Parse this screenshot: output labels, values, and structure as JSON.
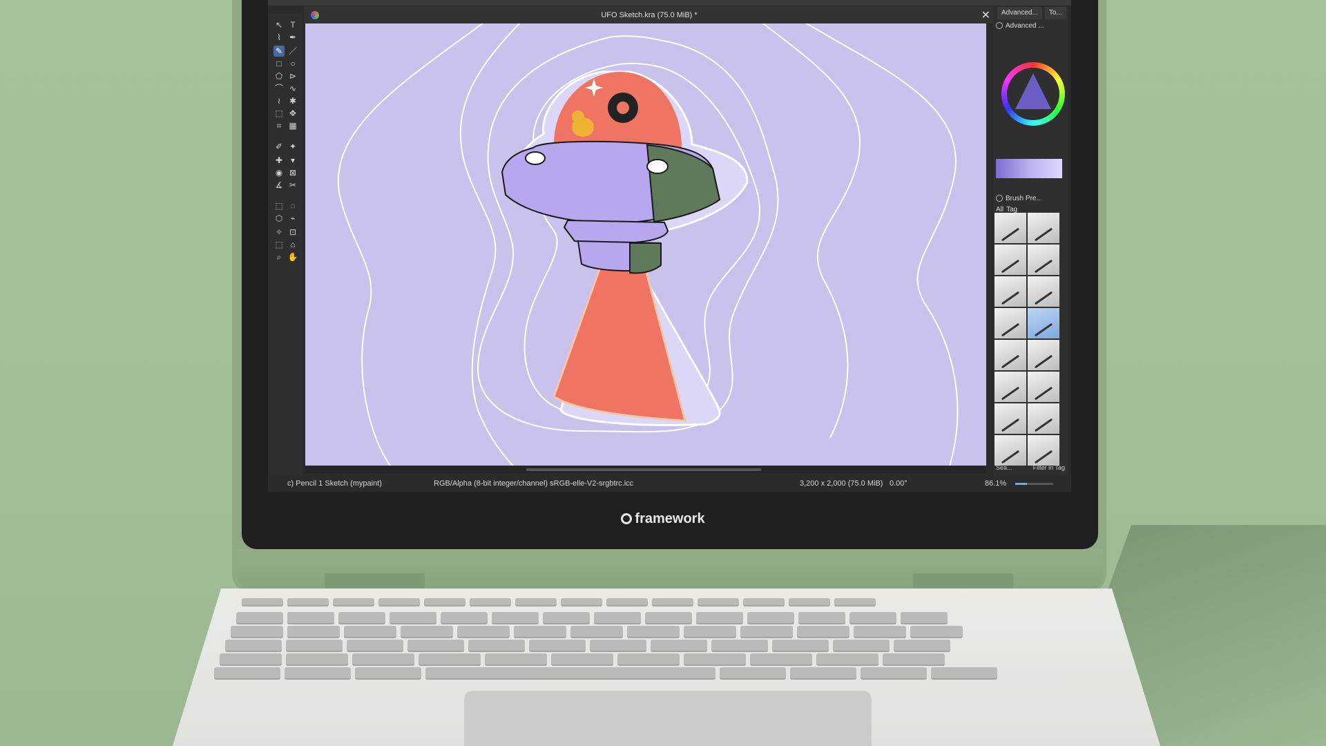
{
  "window": {
    "doc_title": "UFO Sketch.kra (75.0 MiB) *",
    "close_glyph": "✕"
  },
  "dock": {
    "tabs": [
      "Advanced...",
      "To..."
    ],
    "color_panel_title": "Advanced ...",
    "brush_panel_title": "Brush Pre...",
    "brush_filter": "All",
    "brush_tag": "Tag",
    "search_placeholder": "Sea...",
    "filter_in_tag": "Filter in Tag"
  },
  "statusbar": {
    "brush": "c) Pencil 1 Sketch (mypaint)",
    "color_space": "RGB/Alpha (8-bit integer/channel)  sRGB-elle-V2-srgbtrc.icc",
    "dimensions": "3,200 x 2,000 (75.0 MiB)",
    "rotation": "0.00°",
    "zoom": "86.1%"
  },
  "brand": {
    "name": "framework"
  },
  "icons": {
    "tools": [
      "select-icon",
      "text-icon",
      "edit-shapes-icon",
      "calligraphy-icon",
      "freehand-brush-icon",
      "line-icon",
      "rectangle-icon",
      "ellipse-icon",
      "polygon-icon",
      "polyline-icon",
      "bezier-icon",
      "freehand-path-icon",
      "dynamic-brush-icon",
      "multibrush-icon",
      "transform-icon",
      "move-icon",
      "crop-icon",
      "gradient-icon",
      "color-picker-icon",
      "colorize-mask-icon",
      "smart-patch-icon",
      "fill-icon",
      "enclose-fill-icon",
      "assistant-icon",
      "measure-icon",
      "reference-icon",
      "rect-select-icon",
      "ellipse-select-icon",
      "polygon-select-icon",
      "freehand-select-icon",
      "contiguous-select-icon",
      "similar-select-icon",
      "bezier-select-icon",
      "magnetic-select-icon",
      "zoom-icon",
      "pan-icon"
    ]
  },
  "colors": {
    "canvas_bg": "#c9c2ec",
    "ufo_body": "#b8a6ee",
    "ufo_green": "#5f7a5a",
    "beam": "#ef7464",
    "dome": "#ef7464"
  }
}
